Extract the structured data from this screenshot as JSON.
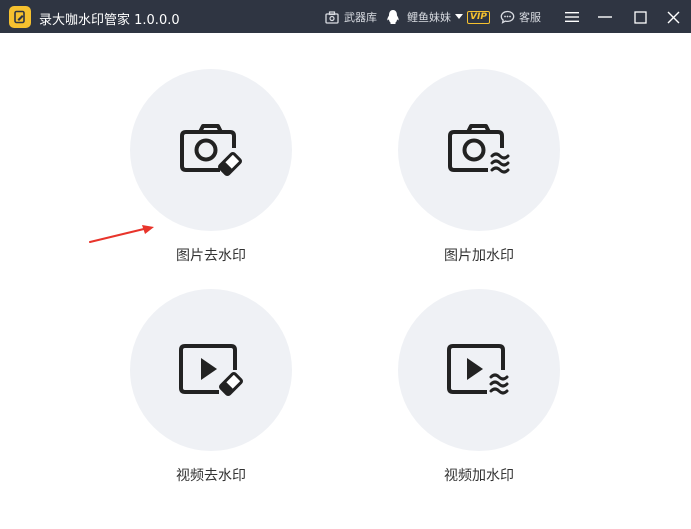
{
  "app": {
    "title": "录大咖水印管家 1.0.0.0",
    "logo_icon": "edit-doc-icon",
    "accent_color": "#f6c12f",
    "titlebar_color": "#2f3542"
  },
  "toolbar": {
    "arsenal_label": "武器库",
    "user_name": "鲤鱼妹妹",
    "vip_label": "VIP",
    "service_label": "客服"
  },
  "features": [
    {
      "label": "图片去水印",
      "icon": "camera-eraser-icon"
    },
    {
      "label": "图片加水印",
      "icon": "camera-wave-icon"
    },
    {
      "label": "视频去水印",
      "icon": "video-eraser-icon"
    },
    {
      "label": "视频加水印",
      "icon": "video-wave-icon"
    }
  ]
}
